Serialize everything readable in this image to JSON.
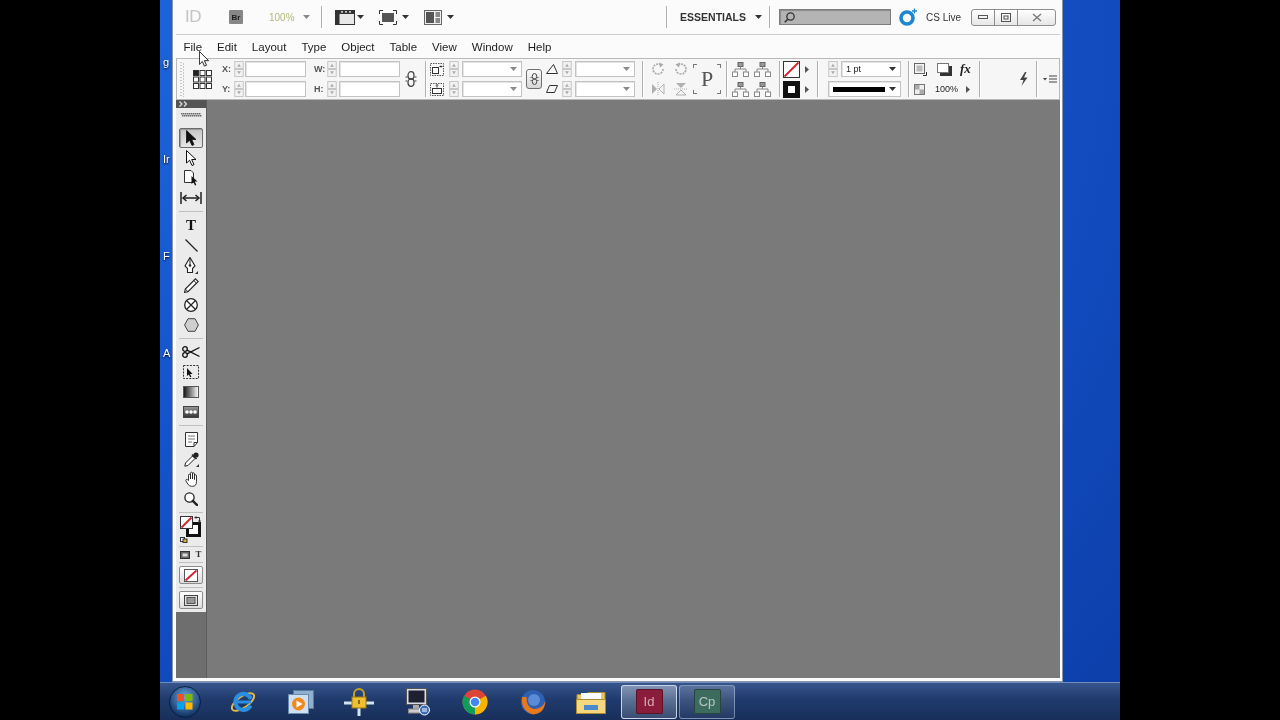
{
  "app_bar": {
    "logo": "ID",
    "bridge": "Br",
    "zoom": {
      "value": "100%",
      "disabled": true
    },
    "workspace": "ESSENTIALS",
    "cs_live": "CS Live"
  },
  "menu": [
    "File",
    "Edit",
    "Layout",
    "Type",
    "Object",
    "Table",
    "View",
    "Window",
    "Help"
  ],
  "control_panel": {
    "position_labels": [
      "X:",
      "Y:"
    ],
    "size_labels": [
      "W:",
      "H:"
    ],
    "flip_indicator": "P",
    "stroke_weight": "1 pt",
    "effects_glyph": "fx",
    "opacity": "100%"
  },
  "tool_groups": [
    {
      "tools": [
        {
          "kind": "selection",
          "selected": true
        },
        {
          "kind": "direct-selection",
          "selected": false
        },
        {
          "kind": "page",
          "selected": false
        },
        {
          "kind": "gap",
          "selected": false
        }
      ]
    },
    {
      "tools": [
        {
          "kind": "type",
          "glyph": "T",
          "selected": false
        },
        {
          "kind": "line",
          "selected": false
        },
        {
          "kind": "pen",
          "selected": false
        },
        {
          "kind": "pencil",
          "selected": false
        },
        {
          "kind": "frame",
          "selected": false
        },
        {
          "kind": "polygon",
          "selected": false
        }
      ]
    },
    {
      "tools": [
        {
          "kind": "scissors",
          "selected": false
        },
        {
          "kind": "free-transform",
          "selected": false
        },
        {
          "kind": "gradient",
          "selected": false
        },
        {
          "kind": "gradient-feather",
          "selected": false
        }
      ]
    },
    {
      "tools": [
        {
          "kind": "note",
          "selected": false
        },
        {
          "kind": "eyedropper",
          "selected": false
        },
        {
          "kind": "hand",
          "selected": false
        },
        {
          "kind": "zoom",
          "selected": false
        }
      ]
    },
    {
      "tools": [
        {
          "kind": "fill-stroke"
        }
      ]
    },
    {
      "tools": [
        {
          "kind": "formatting",
          "glyph": "T"
        }
      ]
    },
    {
      "tools": [
        {
          "kind": "apply-none"
        }
      ]
    },
    {
      "tools": [
        {
          "kind": "screen-mode"
        }
      ]
    }
  ],
  "taskbar": {
    "windows": [
      {
        "label": "Id",
        "color": "#8a1c3c",
        "selected": true
      },
      {
        "label": "Cp",
        "color": "#3d6b5d",
        "selected": false
      }
    ]
  },
  "desktop_labels": [
    "g",
    "Ir",
    "F",
    "A"
  ]
}
